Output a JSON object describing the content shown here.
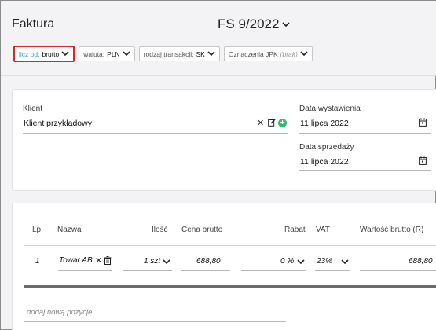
{
  "header": {
    "title": "Faktura",
    "doc_number": "FS 9/2022"
  },
  "options": [
    {
      "label": "licz od:",
      "value": "brutto"
    },
    {
      "label": "waluta:",
      "value": "PLN"
    },
    {
      "label": "rodzaj transakcji:",
      "value": "SK"
    },
    {
      "label": "Oznaczenia JPK",
      "value": "(brak)"
    }
  ],
  "client": {
    "label": "Klient",
    "value": "Klient przykładowy"
  },
  "dates": {
    "issue_label": "Data wystawienia",
    "issue_value": "11 lipca 2022",
    "sale_label": "Data sprzedaży",
    "sale_value": "11 lipca 2022"
  },
  "items_table": {
    "columns": {
      "lp": "Lp.",
      "name": "Nazwa",
      "qty": "Ilość",
      "price": "Cena brutto",
      "discount": "Rabat",
      "vat": "VAT",
      "total": "Wartość brutto (R)"
    },
    "rows": [
      {
        "lp": "1",
        "name": "Towar AB",
        "qty": "1 szt",
        "price": "688,80",
        "discount": "0 %",
        "vat": "23%",
        "total": "688,80"
      }
    ],
    "add_placeholder": "dodaj nową pozycję"
  }
}
